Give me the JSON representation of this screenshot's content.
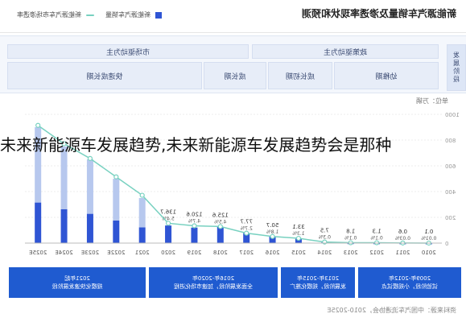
{
  "header": {
    "title": "新能源汽车销量及渗透率现状和预测",
    "legend": [
      {
        "label": "新能源汽车销量",
        "kind": "bar"
      },
      {
        "label": "新能源汽车市场渗透率",
        "kind": "line"
      }
    ]
  },
  "phases": {
    "side_label": "发展阶段",
    "policy_driven": "政策驱动为主",
    "market_driven": "市场驱动为主",
    "stages": [
      "幼稚期",
      "成长初期",
      "成长期",
      "快速成长期"
    ]
  },
  "unit_label": "单位：万辆",
  "colors": {
    "bar_dark": "#2f55d4",
    "bar_light": "#b7c8ee",
    "line": "#78d1c0",
    "bottom": "#1f5bd0"
  },
  "chart_data": {
    "type": "bar",
    "title": "新能源汽车销量及渗透率现状和预测",
    "ylabel": "",
    "unit": "万辆",
    "ylim": [
      0,
      1000
    ],
    "yticks": [
      "0",
      "200",
      "400",
      "600",
      "800",
      "1000"
    ],
    "categories": [
      "2010",
      "2011",
      "2012",
      "2013",
      "2014",
      "2015",
      "2016",
      "2017",
      "2018",
      "2019",
      "2020",
      "2021",
      "2022E",
      "2023E",
      "2024E",
      "2025E"
    ],
    "series": [
      {
        "name": "新能源汽车销量",
        "values": [
          0.1,
          0.6,
          1.3,
          1.8,
          7.5,
          33.1,
          50.7,
          77.7,
          125.6,
          120.6,
          136.7,
          350,
          500,
          650,
          750,
          900
        ]
      },
      {
        "name": "新能源汽车市场渗透率",
        "values": [
          0.01,
          0.03,
          0.1,
          0.1,
          0.3,
          1.3,
          1.8,
          2.7,
          4.5,
          4.7,
          5.4,
          13,
          18,
          23,
          27,
          32
        ]
      }
    ],
    "value_labels": [
      "0.1",
      "0.6",
      "1.3",
      "1.8",
      "7.5",
      "33.1",
      "50.7",
      "77.7",
      "125.6",
      "120.6",
      "136.7",
      "",
      "",
      "",
      "",
      ""
    ],
    "rate_labels": [
      "0.01%",
      "0.03%",
      "0.1%",
      "0.1%",
      "0.3%",
      "1.3%",
      "1.8%",
      "2.7%",
      "4.5%",
      "4.7%",
      "5.4%",
      "",
      "",
      "",
      "",
      ""
    ],
    "gridlines": true,
    "legend_position": "top-left"
  },
  "bottom_boxes": [
    {
      "years": "2009年-2012年",
      "desc": "试验阶段，小规模试点"
    },
    {
      "years": "2013年-2015年",
      "desc": "发展阶段，规模化推广"
    },
    {
      "years": "2016年-2020年",
      "desc": "全面发展阶段，加速市场化进程"
    },
    {
      "years": "2021年起",
      "desc": "规模化快速发展阶段"
    }
  ],
  "source": "资料来源：中国汽车流通协会，2010-2025E",
  "overlay": {
    "text": "未来新能源车发展趋势,未来新能源车发展趋势会是那种"
  }
}
